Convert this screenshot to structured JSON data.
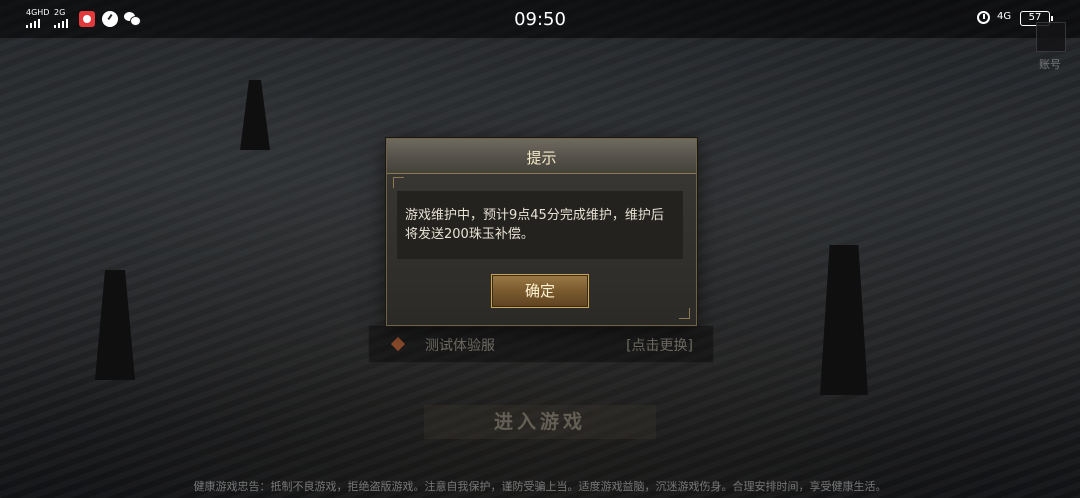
{
  "status_bar": {
    "signal_1_label": "4GHD",
    "signal_2_label": "2G",
    "time": "09:50",
    "network": "4G",
    "battery": "57"
  },
  "account": {
    "label": "账号"
  },
  "dialog": {
    "title": "提示",
    "message": "游戏维护中，预计9点45分完成维护，维护后将发送200珠玉补偿。",
    "confirm_label": "确定"
  },
  "server": {
    "name": "测试体验服",
    "change_label": "[点击更换]"
  },
  "enter_game_label": "进入游戏",
  "footer_text": "健康游戏忠告：抵制不良游戏，拒绝盗版游戏。注意自我保护，谨防受骗上当。适度游戏益脑，沉迷游戏伤身。合理安排时间，享受健康生活。"
}
